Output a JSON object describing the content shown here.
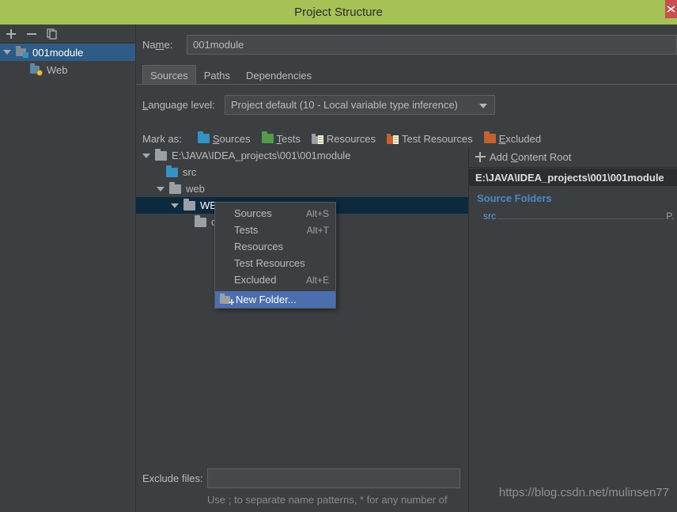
{
  "window": {
    "title": "Project Structure",
    "close_icon": "close-icon"
  },
  "sidebar": {
    "toolbar": [
      {
        "name": "add-button",
        "icon": "plus-icon"
      },
      {
        "name": "remove-button",
        "icon": "minus-icon"
      },
      {
        "name": "copy-button",
        "icon": "copy-icon"
      }
    ],
    "tree": [
      {
        "label": "001module",
        "icon": "module-icon",
        "selected": true,
        "expanded": true,
        "depth": 0
      },
      {
        "label": "Web",
        "icon": "web-facet-icon",
        "selected": false,
        "expanded": false,
        "depth": 1
      }
    ]
  },
  "main": {
    "name_label": "Name:",
    "name_value": "001module",
    "tabs": [
      {
        "label": "Sources",
        "active": true
      },
      {
        "label": "Paths",
        "active": false
      },
      {
        "label": "Dependencies",
        "active": false
      }
    ],
    "language_level": {
      "label": "Language level:",
      "value": "Project default (10 - Local variable type inference)"
    },
    "mark_as": {
      "label": "Mark as:",
      "items": [
        {
          "label": "Sources",
          "color": "#3592c4",
          "icon": "folder-sources-icon"
        },
        {
          "label": "Tests",
          "color": "#529c4c",
          "icon": "folder-tests-icon"
        },
        {
          "label": "Resources",
          "color": "#9aa0a6",
          "icon": "folder-resources-icon"
        },
        {
          "label": "Test Resources",
          "color": "#c4622d",
          "icon": "folder-test-resources-icon"
        },
        {
          "label": "Excluded",
          "color": "#c4622d",
          "icon": "folder-excluded-icon"
        }
      ]
    },
    "content_tree": [
      {
        "label": "E:\\JAVA\\IDEA_projects\\001\\001module",
        "depth": 0,
        "expanded": true,
        "icon": "folder-gray-icon",
        "selected": false
      },
      {
        "label": "src",
        "depth": 1,
        "expanded": false,
        "icon": "folder-blue-icon",
        "selected": false
      },
      {
        "label": "web",
        "depth": 1,
        "expanded": true,
        "icon": "folder-gray-icon",
        "selected": false
      },
      {
        "label": "WEB-INF",
        "depth": 2,
        "expanded": true,
        "icon": "folder-gray-icon",
        "selected": true
      },
      {
        "label": "classes",
        "depth": 3,
        "expanded": false,
        "icon": "folder-gray-icon",
        "selected": false
      }
    ],
    "exclude_files": {
      "label": "Exclude files:",
      "value": "",
      "help": "Use ; to separate name patterns, * for any number of"
    }
  },
  "right_panel": {
    "add_content_root": "Add Content Root",
    "root_path": "E:\\JAVA\\IDEA_projects\\001\\001module",
    "source_folders_title": "Source Folders",
    "source_folders": [
      {
        "name": "src",
        "tail": "P."
      }
    ]
  },
  "context_menu": {
    "items": [
      {
        "label": "Sources",
        "accel": "Alt+S",
        "highlight": false,
        "icon": null
      },
      {
        "label": "Tests",
        "accel": "Alt+T",
        "highlight": false,
        "icon": null
      },
      {
        "label": "Resources",
        "accel": "",
        "highlight": false,
        "icon": null
      },
      {
        "label": "Test Resources",
        "accel": "",
        "highlight": false,
        "icon": null
      },
      {
        "label": "Excluded",
        "accel": "Alt+E",
        "highlight": false,
        "icon": null
      },
      {
        "label": "New Folder...",
        "accel": "",
        "highlight": true,
        "icon": "new-folder-icon"
      }
    ]
  },
  "watermark": "https://blog.csdn.net/mulinsen77",
  "colors": {
    "title_bar": "#a6c156",
    "close_button": "#c75050",
    "background": "#3c3f41",
    "selection_blue": "#2f5c86",
    "tree_selection": "#0d293e",
    "menu_highlight": "#4b6eaf",
    "link_blue": "#4a88c7"
  }
}
